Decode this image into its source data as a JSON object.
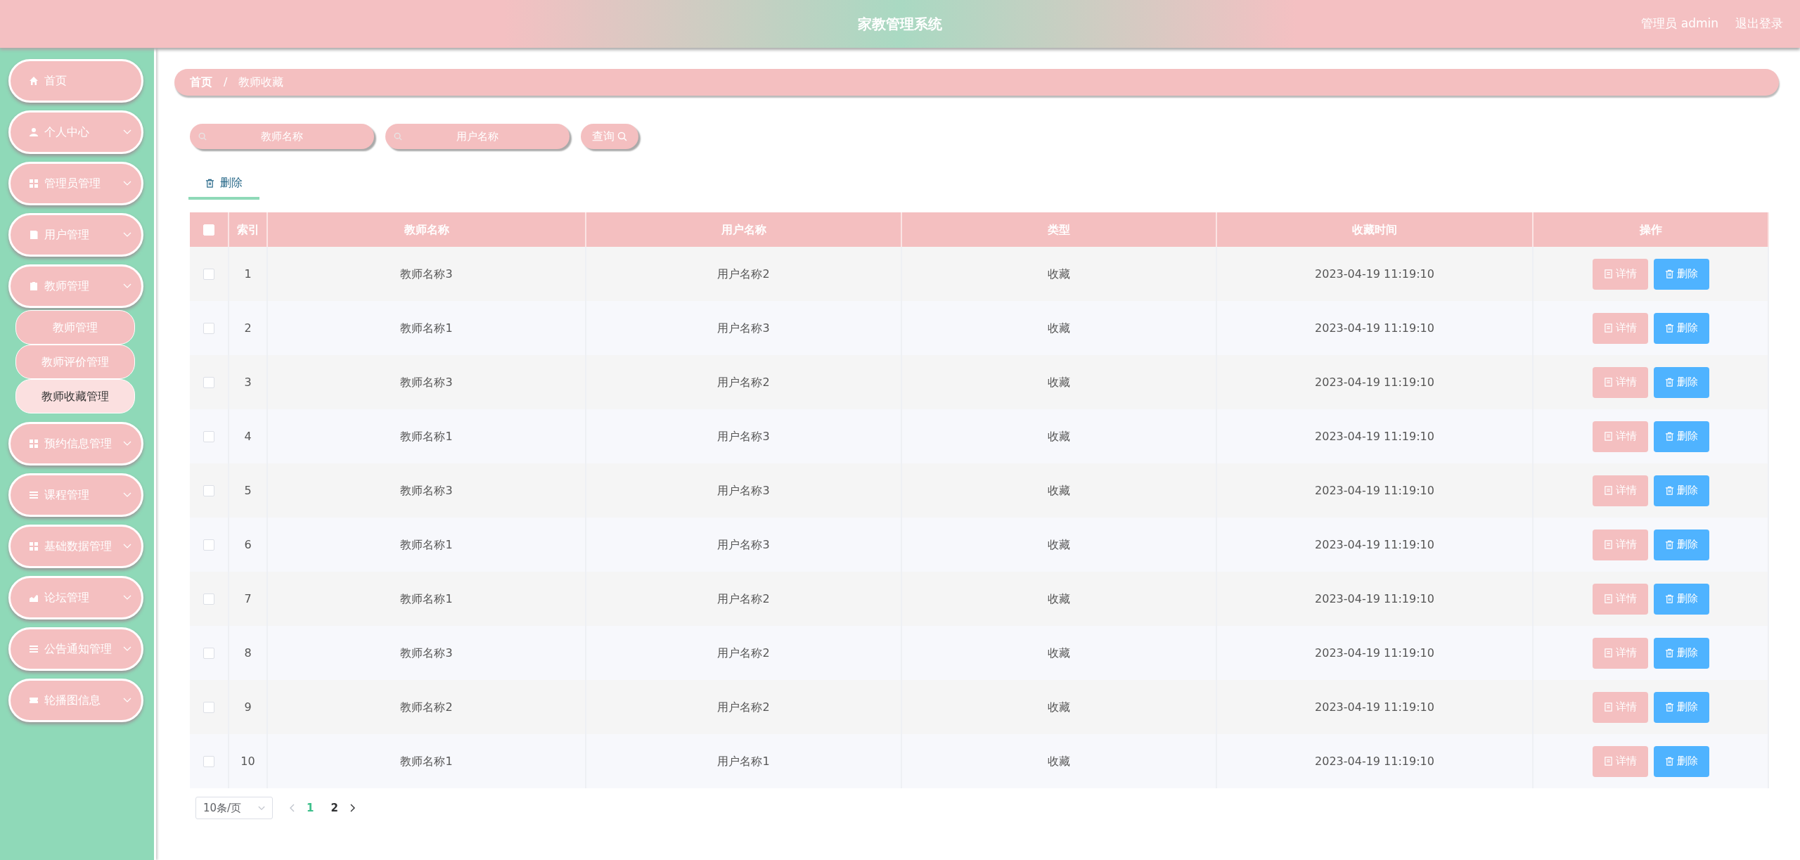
{
  "header": {
    "title": "家教管理系统",
    "user": "管理员 admin",
    "logout": "退出登录"
  },
  "sidebar": {
    "items": [
      {
        "label": "首页",
        "expandable": false
      },
      {
        "label": "个人中心",
        "expandable": true
      },
      {
        "label": "管理员管理",
        "expandable": true
      },
      {
        "label": "用户管理",
        "expandable": true
      },
      {
        "label": "教师管理",
        "expandable": true,
        "children": [
          {
            "label": "教师管理",
            "selected": false
          },
          {
            "label": "教师评价管理",
            "selected": false
          },
          {
            "label": "教师收藏管理",
            "selected": true
          }
        ]
      },
      {
        "label": "预约信息管理",
        "expandable": true
      },
      {
        "label": "课程管理",
        "expandable": true
      },
      {
        "label": "基础数据管理",
        "expandable": true
      },
      {
        "label": "论坛管理",
        "expandable": true
      },
      {
        "label": "公告通知管理",
        "expandable": true
      },
      {
        "label": "轮播图信息",
        "expandable": true
      }
    ]
  },
  "breadcrumb": {
    "items": [
      "首页",
      "教师收藏"
    ],
    "separator": "/"
  },
  "search": {
    "fields": [
      {
        "placeholder": "教师名称"
      },
      {
        "placeholder": "用户名称"
      }
    ],
    "button": "查询"
  },
  "toolbar": {
    "delete": "删除"
  },
  "table": {
    "select_all_checked": false,
    "columns": [
      "索引",
      "教师名称",
      "用户名称",
      "类型",
      "收藏时间",
      "操作"
    ],
    "rows": [
      {
        "checked": false,
        "cells": [
          "1",
          "教师名称3",
          "用户名称2",
          "收藏",
          "2023-04-19 11:19:10"
        ],
        "actions": [
          "详情",
          "删除"
        ]
      },
      {
        "checked": false,
        "cells": [
          "2",
          "教师名称1",
          "用户名称3",
          "收藏",
          "2023-04-19 11:19:10"
        ],
        "actions": [
          "详情",
          "删除"
        ]
      },
      {
        "checked": false,
        "cells": [
          "3",
          "教师名称3",
          "用户名称2",
          "收藏",
          "2023-04-19 11:19:10"
        ],
        "actions": [
          "详情",
          "删除"
        ]
      },
      {
        "checked": false,
        "cells": [
          "4",
          "教师名称1",
          "用户名称3",
          "收藏",
          "2023-04-19 11:19:10"
        ],
        "actions": [
          "详情",
          "删除"
        ]
      },
      {
        "checked": false,
        "cells": [
          "5",
          "教师名称3",
          "用户名称3",
          "收藏",
          "2023-04-19 11:19:10"
        ],
        "actions": [
          "详情",
          "删除"
        ]
      },
      {
        "checked": false,
        "cells": [
          "6",
          "教师名称1",
          "用户名称3",
          "收藏",
          "2023-04-19 11:19:10"
        ],
        "actions": [
          "详情",
          "删除"
        ]
      },
      {
        "checked": false,
        "cells": [
          "7",
          "教师名称1",
          "用户名称2",
          "收藏",
          "2023-04-19 11:19:10"
        ],
        "actions": [
          "详情",
          "删除"
        ]
      },
      {
        "checked": false,
        "cells": [
          "8",
          "教师名称3",
          "用户名称2",
          "收藏",
          "2023-04-19 11:19:10"
        ],
        "actions": [
          "详情",
          "删除"
        ]
      },
      {
        "checked": false,
        "cells": [
          "9",
          "教师名称2",
          "用户名称2",
          "收藏",
          "2023-04-19 11:19:10"
        ],
        "actions": [
          "详情",
          "删除"
        ]
      },
      {
        "checked": false,
        "cells": [
          "10",
          "教师名称1",
          "用户名称1",
          "收藏",
          "2023-04-19 11:19:10"
        ],
        "actions": [
          "详情",
          "删除"
        ]
      }
    ]
  },
  "pagination": {
    "page_size": "10条/页",
    "pages": [
      {
        "label": "1",
        "selected": true
      },
      {
        "label": "2",
        "selected": false
      }
    ]
  }
}
